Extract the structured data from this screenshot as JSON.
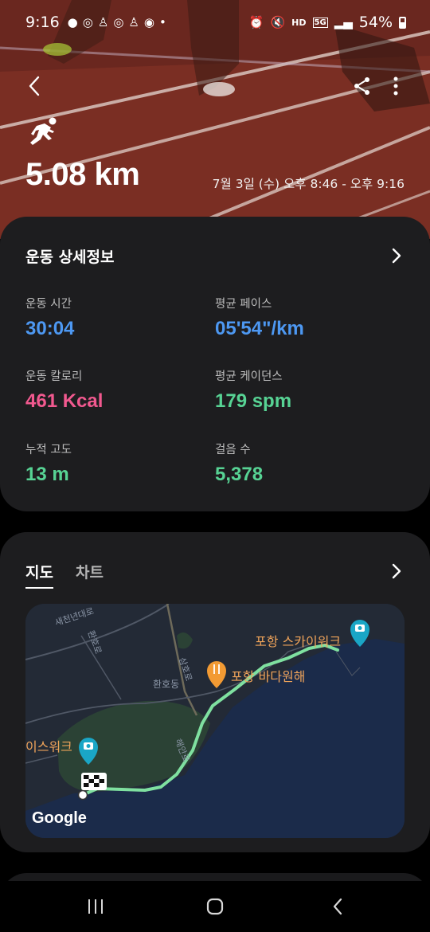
{
  "status_bar": {
    "time": "9:16",
    "battery": "54%",
    "network": "5G",
    "volte": "HD"
  },
  "header": {
    "distance": "5.08 km",
    "datetime": "7월 3일 (수) 오후 8:46 - 오후 9:16"
  },
  "details": {
    "title": "운동 상세정보",
    "stats": [
      {
        "label": "운동 시간",
        "value": "30:04",
        "color": "#4d98f2"
      },
      {
        "label": "평균 페이스",
        "value": "05'54\"/km",
        "color": "#4d98f2"
      },
      {
        "label": "운동 칼로리",
        "value": "461 Kcal",
        "color": "#f2598f"
      },
      {
        "label": "평균 케이던스",
        "value": "179 spm",
        "color": "#57d394"
      },
      {
        "label": "누적 고도",
        "value": "13 m",
        "color": "#57d394"
      },
      {
        "label": "걸음 수",
        "value": "5,378",
        "color": "#57d394"
      }
    ]
  },
  "map_card": {
    "tabs": [
      "지도",
      "차트"
    ],
    "active_tab": "지도",
    "map_labels": {
      "skywalk": "포항 스카이워크",
      "skywalk_partial": "이스워크",
      "restaurant": "포항 바다원해",
      "district": "환호동"
    },
    "road_labels": {
      "road1": "새천년대로",
      "road2": "환호로",
      "road3": "삼호로",
      "road4": "해안로"
    },
    "attribution": "Google",
    "route_color": "#7fe0a0"
  },
  "icons": {
    "back": "chevron-left-icon",
    "share": "share-icon",
    "more": "more-vertical-icon",
    "activity": "running-icon",
    "details_chevron": "chevron-right-icon",
    "map_chevron": "chevron-right-icon"
  }
}
